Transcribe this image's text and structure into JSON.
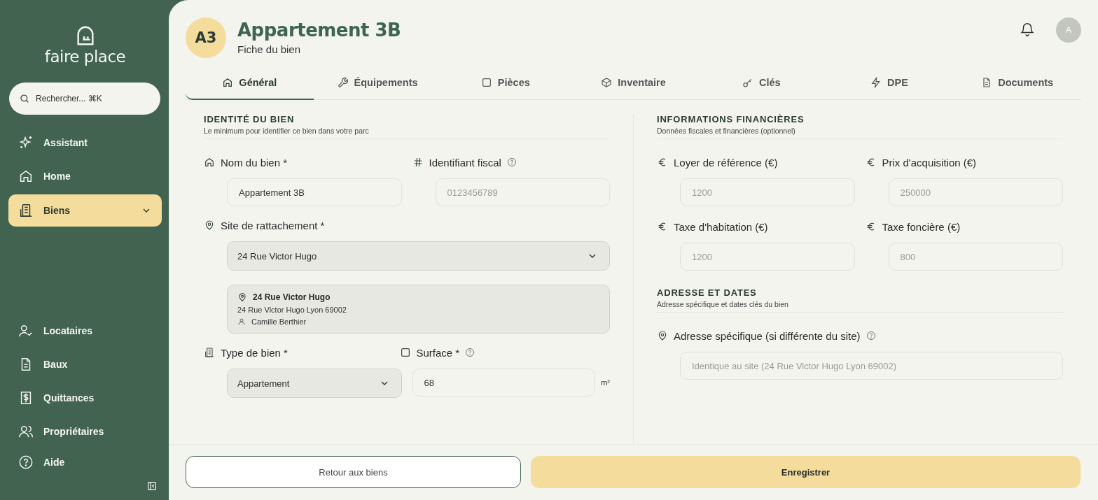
{
  "sidebar": {
    "brand": "faire place",
    "search": {
      "placeholder": "Rechercher... ⌘K"
    },
    "nav_top": [
      {
        "label": "Assistant",
        "selected": false,
        "expandable": false
      },
      {
        "label": "Home",
        "selected": false,
        "expandable": false
      },
      {
        "label": "Biens",
        "selected": true,
        "expandable": true
      }
    ],
    "nav_bottom": [
      {
        "label": "Locataires",
        "selected": false
      },
      {
        "label": "Baux",
        "selected": false
      },
      {
        "label": "Quittances",
        "selected": false
      },
      {
        "label": "Propriétaires",
        "selected": false
      }
    ],
    "help": "Aide"
  },
  "header": {
    "badge": "A3",
    "title": "Appartement 3B",
    "subtitle": "Fiche du bien",
    "user_initial": "A"
  },
  "tabs": [
    {
      "label": "Général",
      "selected": true
    },
    {
      "label": "Équipements",
      "selected": false
    },
    {
      "label": "Pièces",
      "selected": false
    },
    {
      "label": "Inventaire",
      "selected": false
    },
    {
      "label": "Clés",
      "selected": false
    },
    {
      "label": "DPE",
      "selected": false
    },
    {
      "label": "Documents",
      "selected": false
    }
  ],
  "identity": {
    "title": "IDENTITÉ DU BIEN",
    "subtitle": "Le minimum pour identifier ce bien dans votre parc",
    "name_field": {
      "label": "Nom du bien *",
      "help": false,
      "value": "Appartement 3B"
    },
    "fiscal_field": {
      "label": "Identifiant fiscal",
      "help": true,
      "placeholder": "0123456789"
    },
    "site_field": {
      "label": "Site de rattachement *",
      "help": false,
      "value": "24 Rue Victor Hugo"
    },
    "site_card": {
      "name": "24 Rue Victor Hugo",
      "address": "24 Rue Victor Hugo Lyon 69002",
      "contact": "Camille Berthier"
    },
    "type_field": {
      "label": "Type de bien *",
      "help": false,
      "value": "Appartement"
    },
    "surface_field": {
      "label": "Surface *",
      "help": true,
      "value": "68",
      "unit": "m²"
    }
  },
  "financial": {
    "title": "INFORMATIONS FINANCIÈRES",
    "subtitle": "Données fiscales et financières (optionnel)",
    "fields": [
      {
        "label": "Loyer de référence (€)",
        "placeholder": "1200"
      },
      {
        "label": "Prix d'acquisition (€)",
        "placeholder": "250000"
      },
      {
        "label": "Taxe d'habitation (€)",
        "placeholder": "1200"
      },
      {
        "label": "Taxe foncière (€)",
        "placeholder": "800"
      }
    ]
  },
  "address": {
    "title": "ADRESSE ET DATES",
    "subtitle": "Adresse spécifique et dates clés du bien",
    "field": {
      "label": "Adresse spécifique (si différente du site)",
      "help": true,
      "placeholder": "Identique au site (24 Rue Victor Hugo Lyon 69002)"
    }
  },
  "footer": {
    "back": "Retour aux biens",
    "save": "Enregistrer"
  }
}
